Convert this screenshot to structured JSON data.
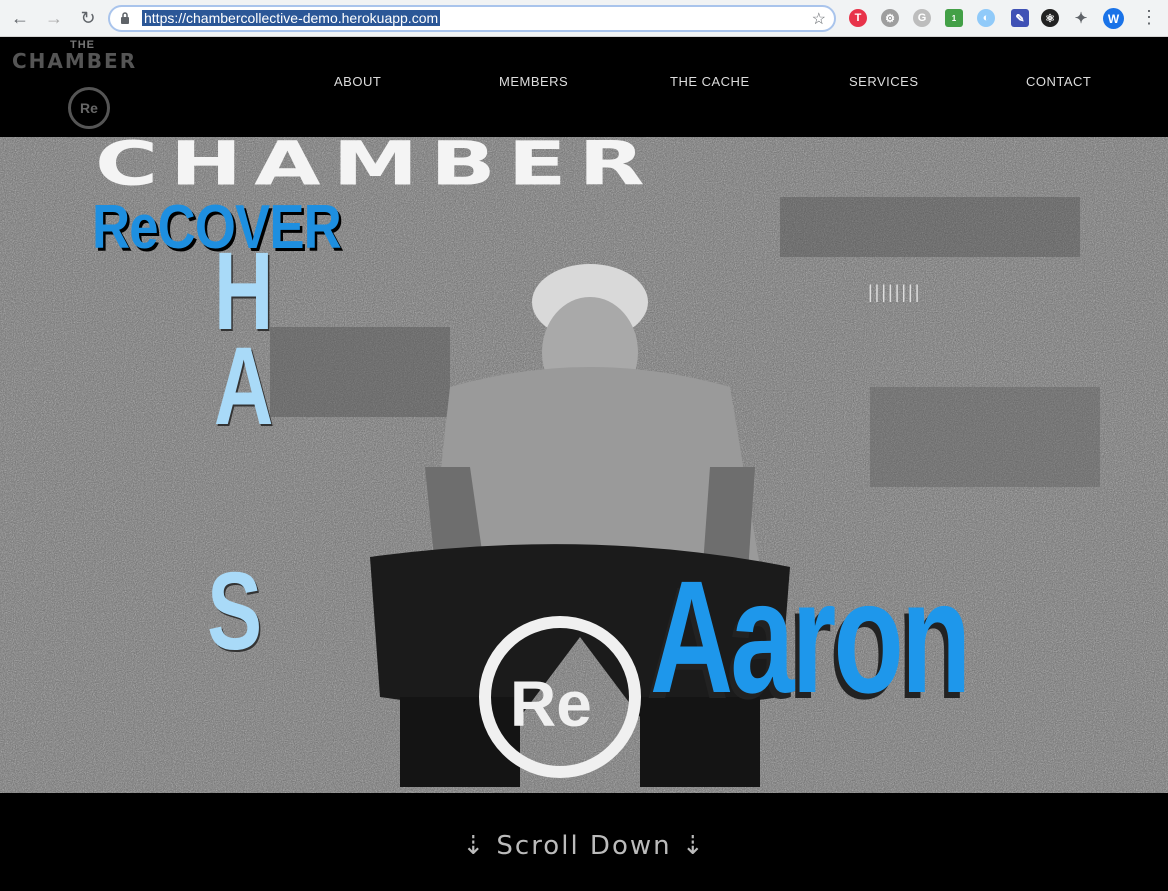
{
  "browser": {
    "url": "https://chambercollective-demo.herokuapp.com",
    "back_icon": "arrow-left-icon",
    "forward_icon": "arrow-right-icon",
    "reload_icon": "reload-icon",
    "profile_initial": "W",
    "extension_badge": "1"
  },
  "header": {
    "logo_the": "THE",
    "logo_chamber": "CHAMBER",
    "logo_mark": "Re",
    "nav": [
      {
        "label": "ABOUT"
      },
      {
        "label": "MEMBERS"
      },
      {
        "label": "THE CACHE"
      },
      {
        "label": "SERVICES"
      },
      {
        "label": "CONTACT"
      }
    ]
  },
  "hero": {
    "title": "CHAMBER",
    "recover": "ReCOVER",
    "vertical_letters": [
      "H",
      "A",
      "S"
    ],
    "name": "Aaron",
    "watermark": "Re"
  },
  "footer": {
    "scroll_label": "⇣ Scroll Down ⇣"
  },
  "colors": {
    "accent_blue": "#1e97eb",
    "light_blue": "#a9daf8",
    "header_bg": "#000000"
  }
}
